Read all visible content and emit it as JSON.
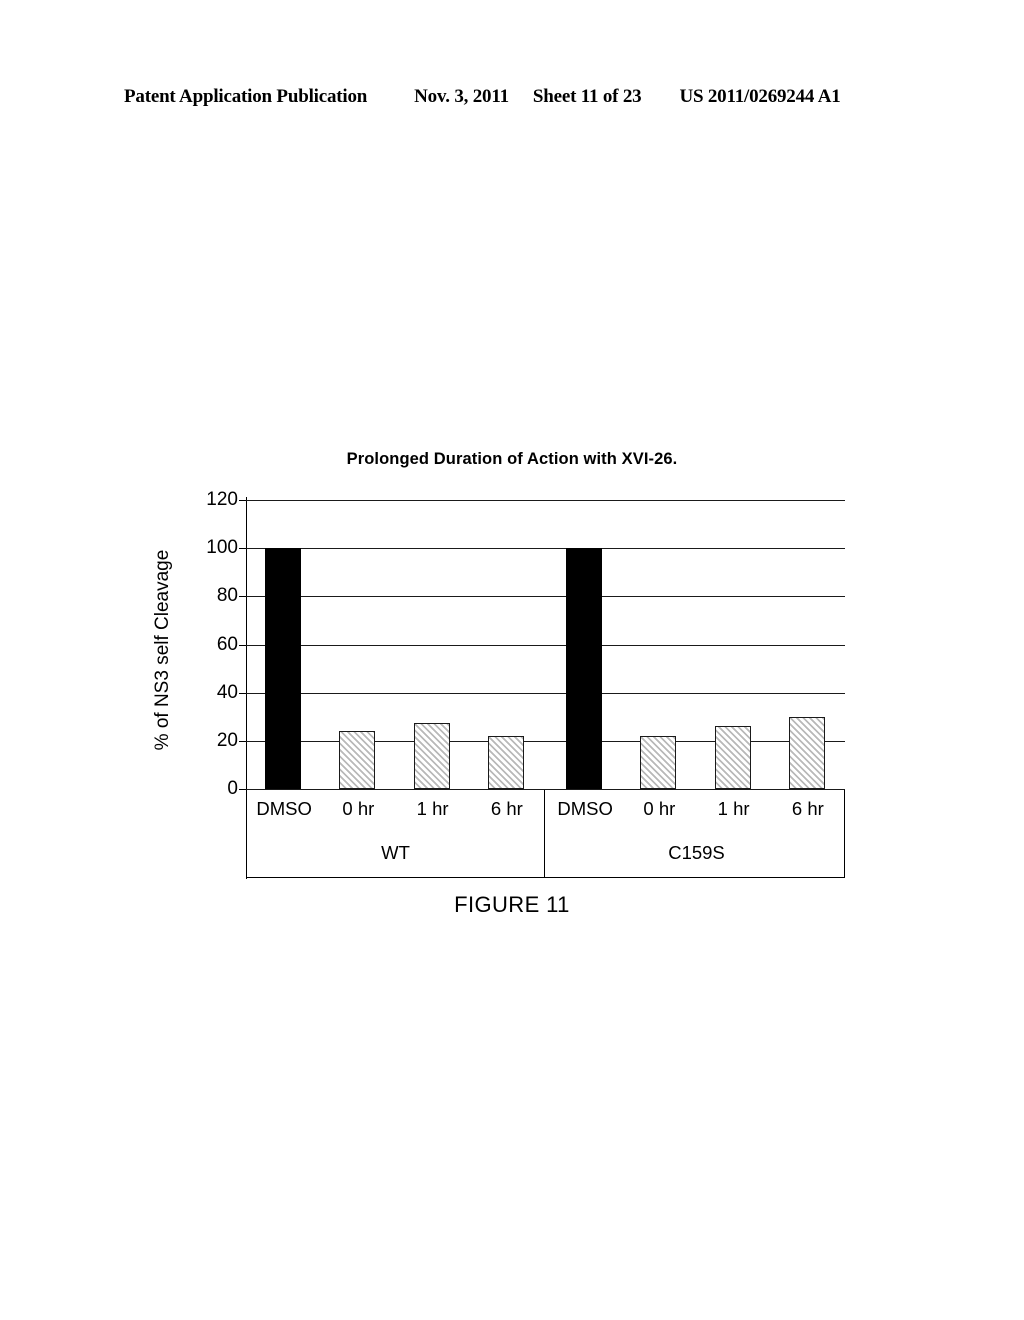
{
  "header": {
    "publication": "Patent Application Publication",
    "date": "Nov. 3, 2011",
    "sheet": "Sheet 11 of 23",
    "number": "US 2011/0269244 A1"
  },
  "figure": {
    "caption": "FIGURE 11"
  },
  "chart_data": {
    "type": "bar",
    "title": "Prolonged Duration of Action with XVI-26.",
    "xlabel": "",
    "ylabel": "% of NS3 self Cleavage",
    "ylim": [
      0,
      120
    ],
    "yticks": [
      0,
      20,
      40,
      60,
      80,
      100,
      120
    ],
    "ytick_labels": [
      "0",
      "20",
      "40",
      "60",
      "80",
      "100",
      "120"
    ],
    "grid": true,
    "legend": "none",
    "categories": [
      "DMSO",
      "0 hr",
      "1 hr",
      "6 hr",
      "DMSO",
      "0 hr",
      "1 hr",
      "6 hr"
    ],
    "values": [
      100,
      24,
      27.5,
      22,
      100,
      22,
      26,
      30
    ],
    "bar_styles": [
      "solid",
      "hatched",
      "hatched",
      "hatched",
      "solid",
      "hatched",
      "hatched",
      "hatched"
    ],
    "groups": [
      {
        "label": "WT",
        "categories": [
          "DMSO",
          "0 hr",
          "1 hr",
          "6 hr"
        ],
        "values": [
          100,
          24,
          27.5,
          22
        ]
      },
      {
        "label": "C159S",
        "categories": [
          "DMSO",
          "0 hr",
          "1 hr",
          "6 hr"
        ],
        "values": [
          100,
          22,
          26,
          30
        ]
      }
    ],
    "colors": {
      "solid_bar": "#000000",
      "hatched_bar_border": "#1a1a1a",
      "hatch_line": "#b9b9b9",
      "gridline": "#1a1a1a"
    }
  }
}
